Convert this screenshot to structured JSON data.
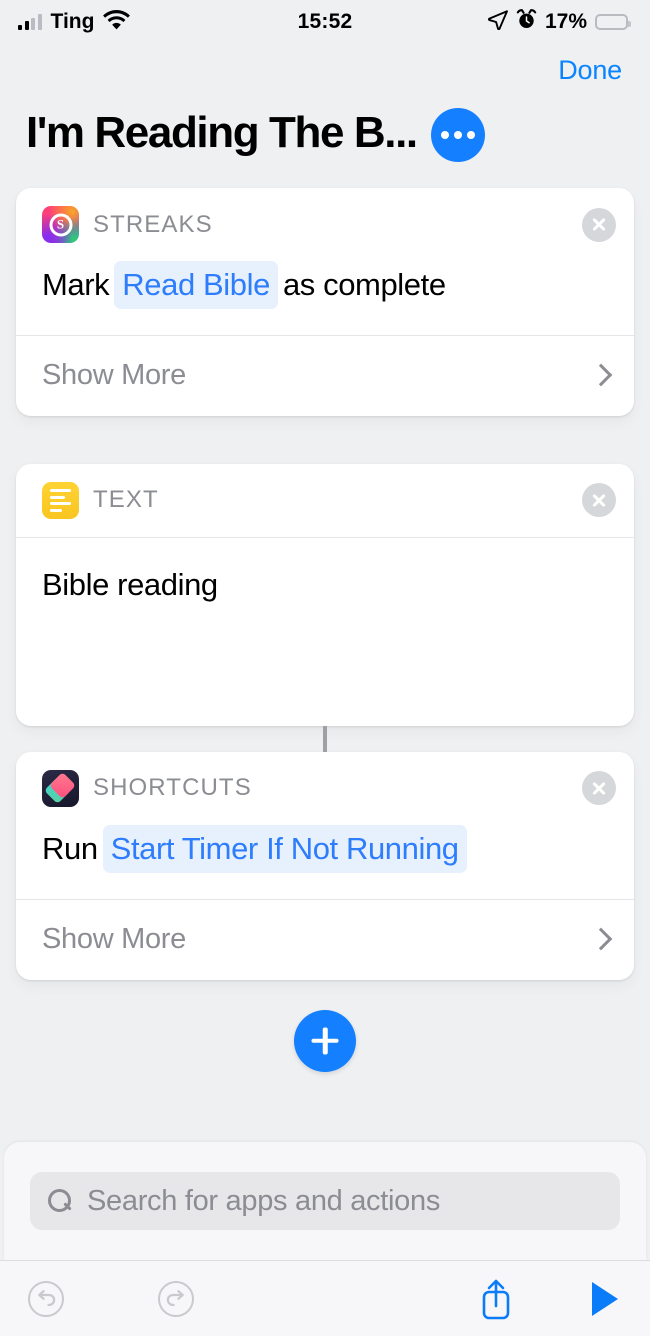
{
  "status_bar": {
    "carrier": "Ting",
    "time": "15:52",
    "battery_percent": "17%",
    "signal_icon": "cellular-bars-icon",
    "wifi_icon": "wifi-icon",
    "location_icon": "location-arrow-icon",
    "alarm_icon": "alarm-clock-icon",
    "battery_icon": "battery-low-icon",
    "battery_fill_color": "#f6cf3e"
  },
  "nav": {
    "done_label": "Done",
    "accent_color": "#0a84ff"
  },
  "header": {
    "title": "I'm Reading The B...",
    "more_button_icon": "ellipsis-icon",
    "more_button_color": "#1580ff"
  },
  "actions": [
    {
      "app_label": "STREAKS",
      "icon": "streaks-app-icon",
      "close_icon": "close-icon",
      "sentence_prefix": "Mark",
      "pill_value": "Read Bible",
      "sentence_suffix": "as complete",
      "show_more_label": "Show More",
      "chevron_icon": "chevron-right-icon"
    },
    {
      "app_label": "TEXT",
      "icon": "text-app-icon",
      "close_icon": "close-icon",
      "text_value": "Bible reading"
    },
    {
      "app_label": "SHORTCUTS",
      "icon": "shortcuts-app-icon",
      "close_icon": "close-icon",
      "sentence_prefix": "Run",
      "pill_value": "Start Timer If Not Running",
      "show_more_label": "Show More",
      "chevron_icon": "chevron-right-icon"
    }
  ],
  "add_action": {
    "icon": "plus-icon",
    "color": "#1580ff"
  },
  "search": {
    "placeholder": "Search for apps and actions",
    "icon": "search-icon"
  },
  "toolbar": {
    "undo_icon": "undo-icon",
    "redo_icon": "redo-icon",
    "share_icon": "share-icon",
    "play_icon": "play-icon",
    "disabled_color": "#c4c5c9",
    "active_color": "#0a7cf9"
  },
  "pill_style": {
    "text_color": "#2d7dfc",
    "background_color": "#e7f0fd"
  }
}
